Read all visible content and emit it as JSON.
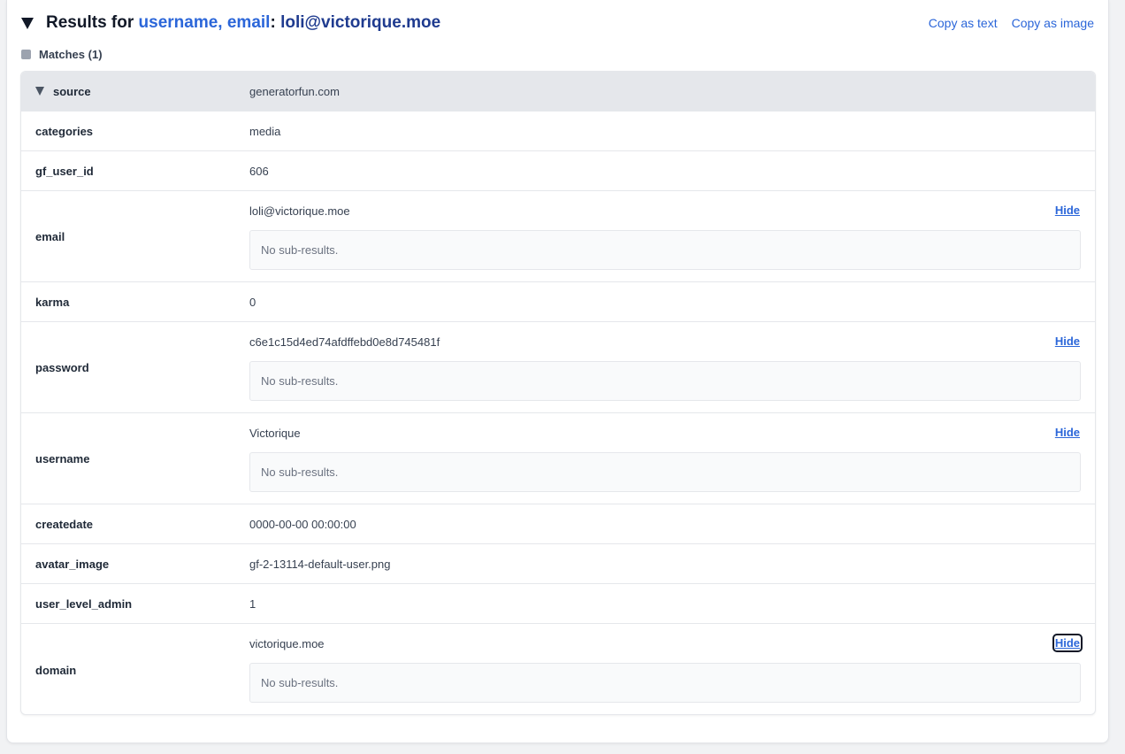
{
  "header": {
    "prefix": "Results for ",
    "fields": "username, email",
    "separator": ": ",
    "query": "loli@victorique.moe",
    "copy_text": "Copy as text",
    "copy_image": "Copy as image"
  },
  "matches": {
    "label": "Matches (1)"
  },
  "rows": [
    {
      "key": "source",
      "value": "generatorfun.com"
    },
    {
      "key": "categories",
      "value": "media"
    },
    {
      "key": "gf_user_id",
      "value": "606"
    },
    {
      "key": "email",
      "value": "loli@victorique.moe",
      "hide": "Hide",
      "sub": "No sub-results."
    },
    {
      "key": "karma",
      "value": "0"
    },
    {
      "key": "password",
      "value": "c6e1c15d4ed74afdffebd0e8d745481f",
      "hide": "Hide",
      "sub": "No sub-results."
    },
    {
      "key": "username",
      "value": "Victorique",
      "hide": "Hide",
      "sub": "No sub-results."
    },
    {
      "key": "createdate",
      "value": "0000-00-00 00:00:00"
    },
    {
      "key": "avatar_image",
      "value": "gf-2-13114-default-user.png"
    },
    {
      "key": "user_level_admin",
      "value": "1"
    },
    {
      "key": "domain",
      "value": "victorique.moe",
      "hide": "Hide",
      "sub": "No sub-results."
    }
  ]
}
